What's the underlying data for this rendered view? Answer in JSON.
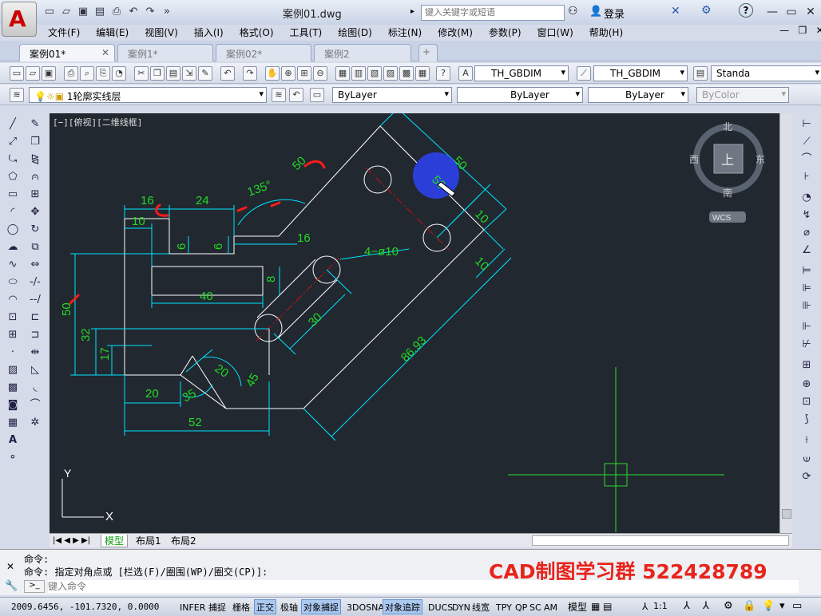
{
  "title": {
    "document": "案例01.dwg",
    "search_placeholder": "键入关键字或短语",
    "login": "登录",
    "help": "?"
  },
  "menus": [
    "文件(F)",
    "编辑(E)",
    "视图(V)",
    "插入(I)",
    "格式(O)",
    "工具(T)",
    "绘图(D)",
    "标注(N)",
    "修改(M)",
    "参数(P)",
    "窗口(W)",
    "帮助(H)"
  ],
  "tabs": [
    "案例01*",
    "案例1*",
    "案例02*",
    "案例2"
  ],
  "styles": {
    "dim_style": "TH_GBDIM",
    "dim_style2": "TH_GBDIM",
    "text_style": "Standa"
  },
  "layers": {
    "current_layer": "1轮廓实线层",
    "color": "ByLayer",
    "linetype": "ByLayer",
    "lineweight": "ByLayer",
    "plotstyle": "ByColor"
  },
  "viewport": {
    "label": "[−][俯视][二维线框]"
  },
  "viewcube": {
    "north": "北",
    "south": "南",
    "east": "东",
    "west": "西",
    "top": "上",
    "wcs": "WCS"
  },
  "drawing": {
    "dims": [
      "16",
      "24",
      "10",
      "135°",
      "50",
      "50",
      "10",
      "6",
      "6",
      "16",
      "4−ø10",
      "40",
      "8",
      "50",
      "32",
      "17",
      "30",
      "10",
      "86.93",
      "20",
      "20",
      "35",
      "45",
      "52"
    ],
    "ucs_x": "X",
    "ucs_y": "Y"
  },
  "layout_tabs": [
    "模型",
    "布局1",
    "布局2"
  ],
  "command": {
    "history1": "命令:",
    "history2": "命令: 指定对角点或 [栏选(F)/圈围(WP)/圈交(CP)]:",
    "prompt_placeholder": "键入命令"
  },
  "watermark": "CAD制图学习群 522428789",
  "status": {
    "coords": "2009.6456,  -101.7320, 0.0000",
    "buttons": [
      "INFER",
      "捕捉",
      "栅格",
      "正交",
      "极轴",
      "对象捕捉",
      "3DOSNAP",
      "对象追踪",
      "DUCS",
      "DYN",
      "线宽",
      "TPY",
      "QP",
      "SC",
      "AM"
    ],
    "model": "模型",
    "scale": "1:1"
  },
  "colors": {
    "canvas": "#212830",
    "dim": "#00e5ff",
    "geometry": "#ffffff",
    "dimtext": "#23d923",
    "center": "#d21010",
    "markup": "#ff1a1a"
  }
}
